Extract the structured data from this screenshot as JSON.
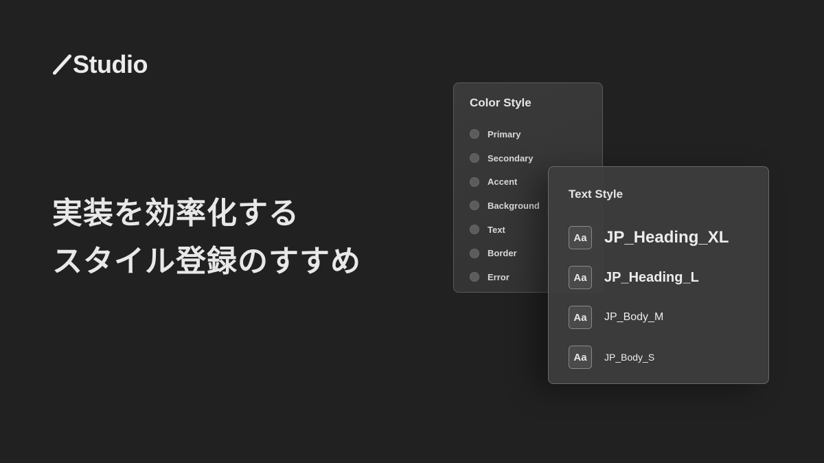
{
  "brand": {
    "name": "Studio"
  },
  "headline": {
    "line1": "実装を効率化する",
    "line2": "スタイル登録のすすめ"
  },
  "color_panel": {
    "title": "Color Style",
    "items": [
      {
        "label": "Primary"
      },
      {
        "label": "Secondary"
      },
      {
        "label": "Accent"
      },
      {
        "label": "Background"
      },
      {
        "label": "Text"
      },
      {
        "label": "Border"
      },
      {
        "label": "Error"
      }
    ]
  },
  "text_panel": {
    "title": "Text Style",
    "badge": "Aa",
    "items": [
      {
        "label": "JP_Heading_XL"
      },
      {
        "label": "JP_Heading_L"
      },
      {
        "label": "JP_Body_M"
      },
      {
        "label": "JP_Body_S"
      }
    ]
  },
  "colors": {
    "background": "#212121",
    "panel": "#3a3a3a",
    "swatch": "#5c5c5c",
    "text": "#ececec"
  }
}
